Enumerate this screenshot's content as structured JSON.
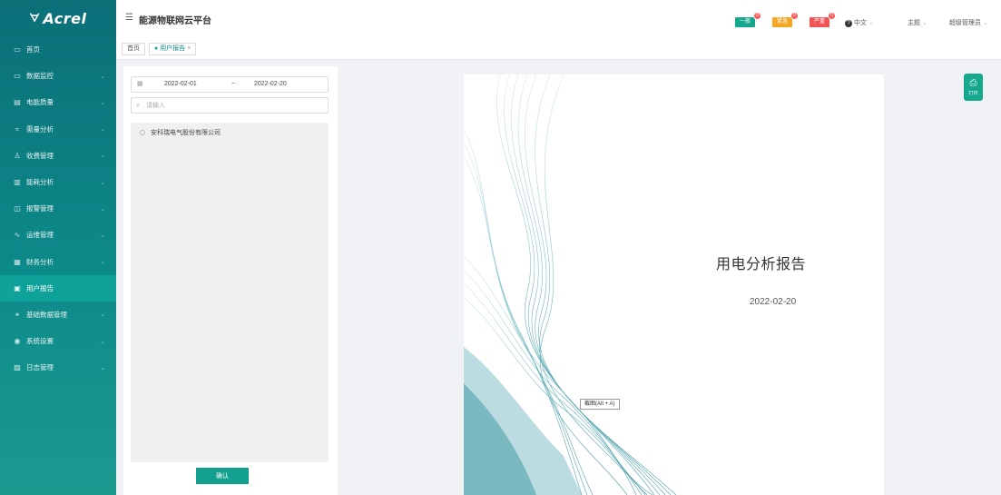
{
  "brand": {
    "logo_text": "Acrel"
  },
  "sidebar": {
    "items": [
      {
        "label": "首页",
        "icon": "monitor-icon",
        "glyph": "▭",
        "has_children": false,
        "active": false
      },
      {
        "label": "数据监控",
        "icon": "monitor-icon",
        "glyph": "▭",
        "has_children": true,
        "active": false
      },
      {
        "label": "电能质量",
        "icon": "quality-icon",
        "glyph": "▤",
        "has_children": true,
        "active": false
      },
      {
        "label": "需量分析",
        "icon": "demand-icon",
        "glyph": "≈",
        "has_children": true,
        "active": false
      },
      {
        "label": "收费管理",
        "icon": "user-icon",
        "glyph": "♙",
        "has_children": true,
        "active": false
      },
      {
        "label": "能耗分析",
        "icon": "bar-chart-icon",
        "glyph": "▥",
        "has_children": true,
        "active": false
      },
      {
        "label": "报警管理",
        "icon": "alarm-icon",
        "glyph": "◫",
        "has_children": true,
        "active": false
      },
      {
        "label": "运维管理",
        "icon": "pulse-icon",
        "glyph": "∿",
        "has_children": true,
        "active": false
      },
      {
        "label": "财务分析",
        "icon": "finance-chart-icon",
        "glyph": "▦",
        "has_children": true,
        "active": false
      },
      {
        "label": "用户报告",
        "icon": "report-icon",
        "glyph": "▣",
        "has_children": false,
        "active": true
      },
      {
        "label": "基础数据管理",
        "icon": "data-node-icon",
        "glyph": "⚹",
        "has_children": true,
        "active": false
      },
      {
        "label": "系统设置",
        "icon": "settings-icon",
        "glyph": "◉",
        "has_children": true,
        "active": false
      },
      {
        "label": "日志管理",
        "icon": "log-icon",
        "glyph": "▨",
        "has_children": true,
        "active": false
      }
    ]
  },
  "header": {
    "title": "能源物联网云平台",
    "alarms": [
      {
        "label": "一般",
        "count": "0",
        "color": "#16a88f"
      },
      {
        "label": "紧急",
        "count": "0",
        "color": "#f5a623"
      },
      {
        "label": "严重",
        "count": "0",
        "color": "#f05454"
      }
    ],
    "language": "中文",
    "theme": "主题",
    "user": "超级管理员"
  },
  "breadcrumb": {
    "home": "首页",
    "current": "用户报告"
  },
  "filter": {
    "start_date": "2022-02-01",
    "separator": "~",
    "end_date": "2022-02-20",
    "search_placeholder": "请输入",
    "tree_items": [
      "安科瑞电气股份有限公司"
    ],
    "confirm_label": "确认"
  },
  "report": {
    "title": "用电分析报告",
    "date": "2022-02-20",
    "screenshot_tooltip": "截图(Alt + A)"
  },
  "print": {
    "label": "打印"
  },
  "colors": {
    "sidebar": "#0b6f78",
    "accent": "#16a88f",
    "active_item": "#0fa29a"
  }
}
